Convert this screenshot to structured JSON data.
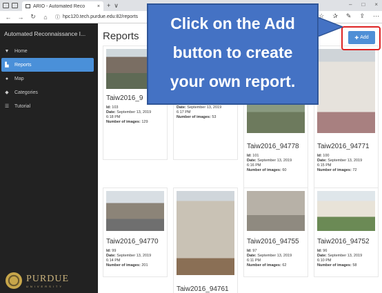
{
  "browser": {
    "tab_title": "ARIO - Automated Reco",
    "tab_close": "×",
    "new_tab": "+",
    "tab_menu": "∨",
    "url": "hpc120.tech.purdue.edu:82/reports",
    "window_controls": [
      "–",
      "□",
      "×"
    ]
  },
  "sidebar": {
    "brand": "Automated Reconnaissance I...",
    "items": [
      {
        "label": "Home",
        "icon": "thumbtack-icon"
      },
      {
        "label": "Reports",
        "icon": "file-icon",
        "active": true
      },
      {
        "label": "Map",
        "icon": "map-marker-icon"
      },
      {
        "label": "Categories",
        "icon": "tags-icon"
      },
      {
        "label": "Tutorial",
        "icon": "list-icon"
      }
    ],
    "logo_name": "PURDUE",
    "logo_sub": "UNIVERSITY"
  },
  "main": {
    "title": "Reports",
    "add_button": "Add",
    "accent_color": "#4f8fd6"
  },
  "callout": {
    "lines": [
      "Click on the Add",
      "button to create",
      "your own report."
    ],
    "color": "#4472c4"
  },
  "cards": [
    {
      "title": "Taiw2016_9",
      "id": "103",
      "date": "September 13, 2019",
      "time": "6:18 PM",
      "images": "129"
    },
    {
      "title": "",
      "id": "",
      "date": "September 13, 2019",
      "time": "6:17 PM",
      "images": "53"
    },
    {
      "title": "Taiw2016_94778",
      "id": "101",
      "date": "September 13, 2019",
      "time": "6:16 PM",
      "images": "60"
    },
    {
      "title": "Taiw2016_94771",
      "id": "100",
      "date": "September 13, 2019",
      "time": "6:15 PM",
      "images": "72"
    },
    {
      "title": "Taiw2016_94770",
      "id": "99",
      "date": "September 13, 2019",
      "time": "6:14 PM",
      "images": "201"
    },
    {
      "title": "Taiw2016_94761",
      "id": "",
      "date": "",
      "time": "",
      "images": ""
    },
    {
      "title": "Taiw2016_94755",
      "id": "97",
      "date": "September 13, 2019",
      "time": "6:11 PM",
      "images": "62"
    },
    {
      "title": "Taiw2016_94752",
      "id": "96",
      "date": "September 13, 2019",
      "time": "6:10 PM",
      "images": "58"
    }
  ],
  "labels": {
    "id": "Id:",
    "date": "Date:",
    "images": "Number of images:"
  }
}
